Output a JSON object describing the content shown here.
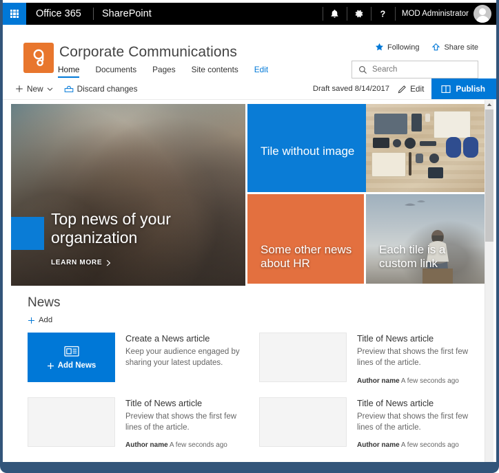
{
  "suite_bar": {
    "waffle_label": "app-launcher",
    "office_label": "Office 365",
    "app_label": "SharePoint",
    "notifications_icon": "bell-icon",
    "settings_icon": "gear-icon",
    "help_icon": "help-icon",
    "user_name": "MOD Administrator"
  },
  "site_header": {
    "logo_glyph": "g",
    "logo_color": "#e8762d",
    "title": "Corporate Communications",
    "nav": [
      {
        "label": "Home",
        "selected": true
      },
      {
        "label": "Documents",
        "selected": false
      },
      {
        "label": "Pages",
        "selected": false
      },
      {
        "label": "Site contents",
        "selected": false
      },
      {
        "label": "Edit",
        "selected": false,
        "accent": true
      }
    ],
    "following_label": "Following",
    "following_icon": "star-icon",
    "share_label": "Share site",
    "share_icon": "share-icon",
    "search_placeholder": "Search",
    "search_value": "",
    "search_icon": "search-icon"
  },
  "command_bar": {
    "new_label": "New",
    "new_icon": "plus-icon",
    "new_chevron": "chevron-down-icon",
    "discard_label": "Discard changes",
    "discard_icon": "undo-icon",
    "draft_status": "Draft saved 8/14/2017",
    "edit_label": "Edit",
    "edit_icon": "pencil-icon",
    "publish_label": "Publish",
    "publish_icon": "publish-icon",
    "publish_color": "#0078d7"
  },
  "hero": {
    "accent_color": "#0a7cd6",
    "tiles": [
      {
        "title": "Top news of your organization",
        "kind": "photo-crowd",
        "cta_label": "LEARN MORE",
        "cta_icon": "chevron-right-icon"
      },
      {
        "title": "Tile without image",
        "kind": "solid-blue"
      },
      {
        "title": "Some other news about HR",
        "kind": "photo-orange"
      },
      {
        "title": "Each tile is a custom link",
        "kind": "photo-sky"
      }
    ]
  },
  "news": {
    "heading": "News",
    "add_label": "Add",
    "add_icon": "plus-icon",
    "promo": {
      "tile_icon": "news-icon",
      "tile_label": "Add News",
      "tile_plus": "plus-icon",
      "title": "Create a News article",
      "description": "Keep your audience engaged by sharing your latest updates."
    },
    "cards": [
      {
        "title": "Title of News article",
        "preview": "Preview that shows the first few lines of the article.",
        "author": "Author name",
        "time": "A few seconds ago"
      },
      {
        "title": "Title of News article",
        "preview": "Preview that shows the first few lines of the article.",
        "author": "Author name",
        "time": "A few seconds ago"
      },
      {
        "title": "Title of News article",
        "preview": "Preview that shows the first few lines of the article.",
        "author": "Author name",
        "time": "A few seconds ago"
      }
    ]
  },
  "scrollbar": {
    "up_icon": "caret-up-icon"
  }
}
